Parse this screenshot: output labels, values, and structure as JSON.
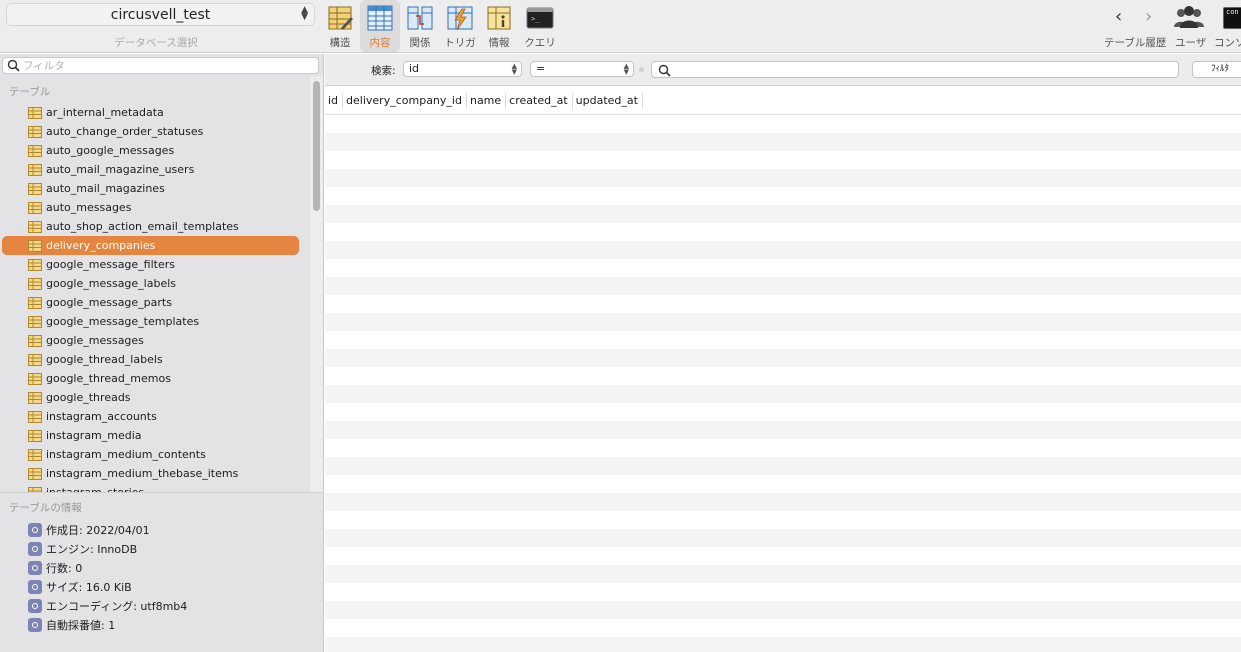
{
  "database": {
    "selected": "circusvell_test",
    "caption": "データベース選択"
  },
  "toolbar": {
    "buttons": [
      {
        "label": "構造",
        "icon": "structure-icon"
      },
      {
        "label": "内容",
        "icon": "content-icon",
        "active": true
      },
      {
        "label": "関係",
        "icon": "relations-icon"
      },
      {
        "label": "トリガ",
        "icon": "triggers-icon"
      },
      {
        "label": "情報",
        "icon": "info-icon"
      },
      {
        "label": "クエリ",
        "icon": "query-icon"
      }
    ],
    "history_label": "テーブル履歴",
    "users_label": "ユーザ",
    "console_label": "コンソ",
    "console_icon_text": "con"
  },
  "sidebar": {
    "filter_placeholder": "フィルタ",
    "tables_title": "テーブル",
    "tables": [
      "ar_internal_metadata",
      "auto_change_order_statuses",
      "auto_google_messages",
      "auto_mail_magazine_users",
      "auto_mail_magazines",
      "auto_messages",
      "auto_shop_action_email_templates",
      "delivery_companies",
      "google_message_filters",
      "google_message_labels",
      "google_message_parts",
      "google_message_templates",
      "google_messages",
      "google_thread_labels",
      "google_thread_memos",
      "google_threads",
      "instagram_accounts",
      "instagram_media",
      "instagram_medium_contents",
      "instagram_medium_thebase_items",
      "instagram_stories"
    ],
    "selected_table": "delivery_companies",
    "info_title": "テーブルの情報",
    "info": [
      "作成日: 2022/04/01",
      "エンジン: InnoDB",
      "行数: 0",
      "サイズ: 16.0 KiB",
      "エンコーディング: utf8mb4",
      "自動採番値: 1"
    ]
  },
  "search": {
    "label": "検索:",
    "field_value": "id",
    "operator_value": "=",
    "query_value": "",
    "filter_button": "ﾌｨﾙﾀ"
  },
  "grid": {
    "columns": [
      "id",
      "delivery_company_id",
      "name",
      "created_at",
      "updated_at"
    ]
  },
  "colors": {
    "accent": "#e5853f",
    "sidebar_bg": "#e3e3e5",
    "toolbar_bg": "#ededed"
  }
}
